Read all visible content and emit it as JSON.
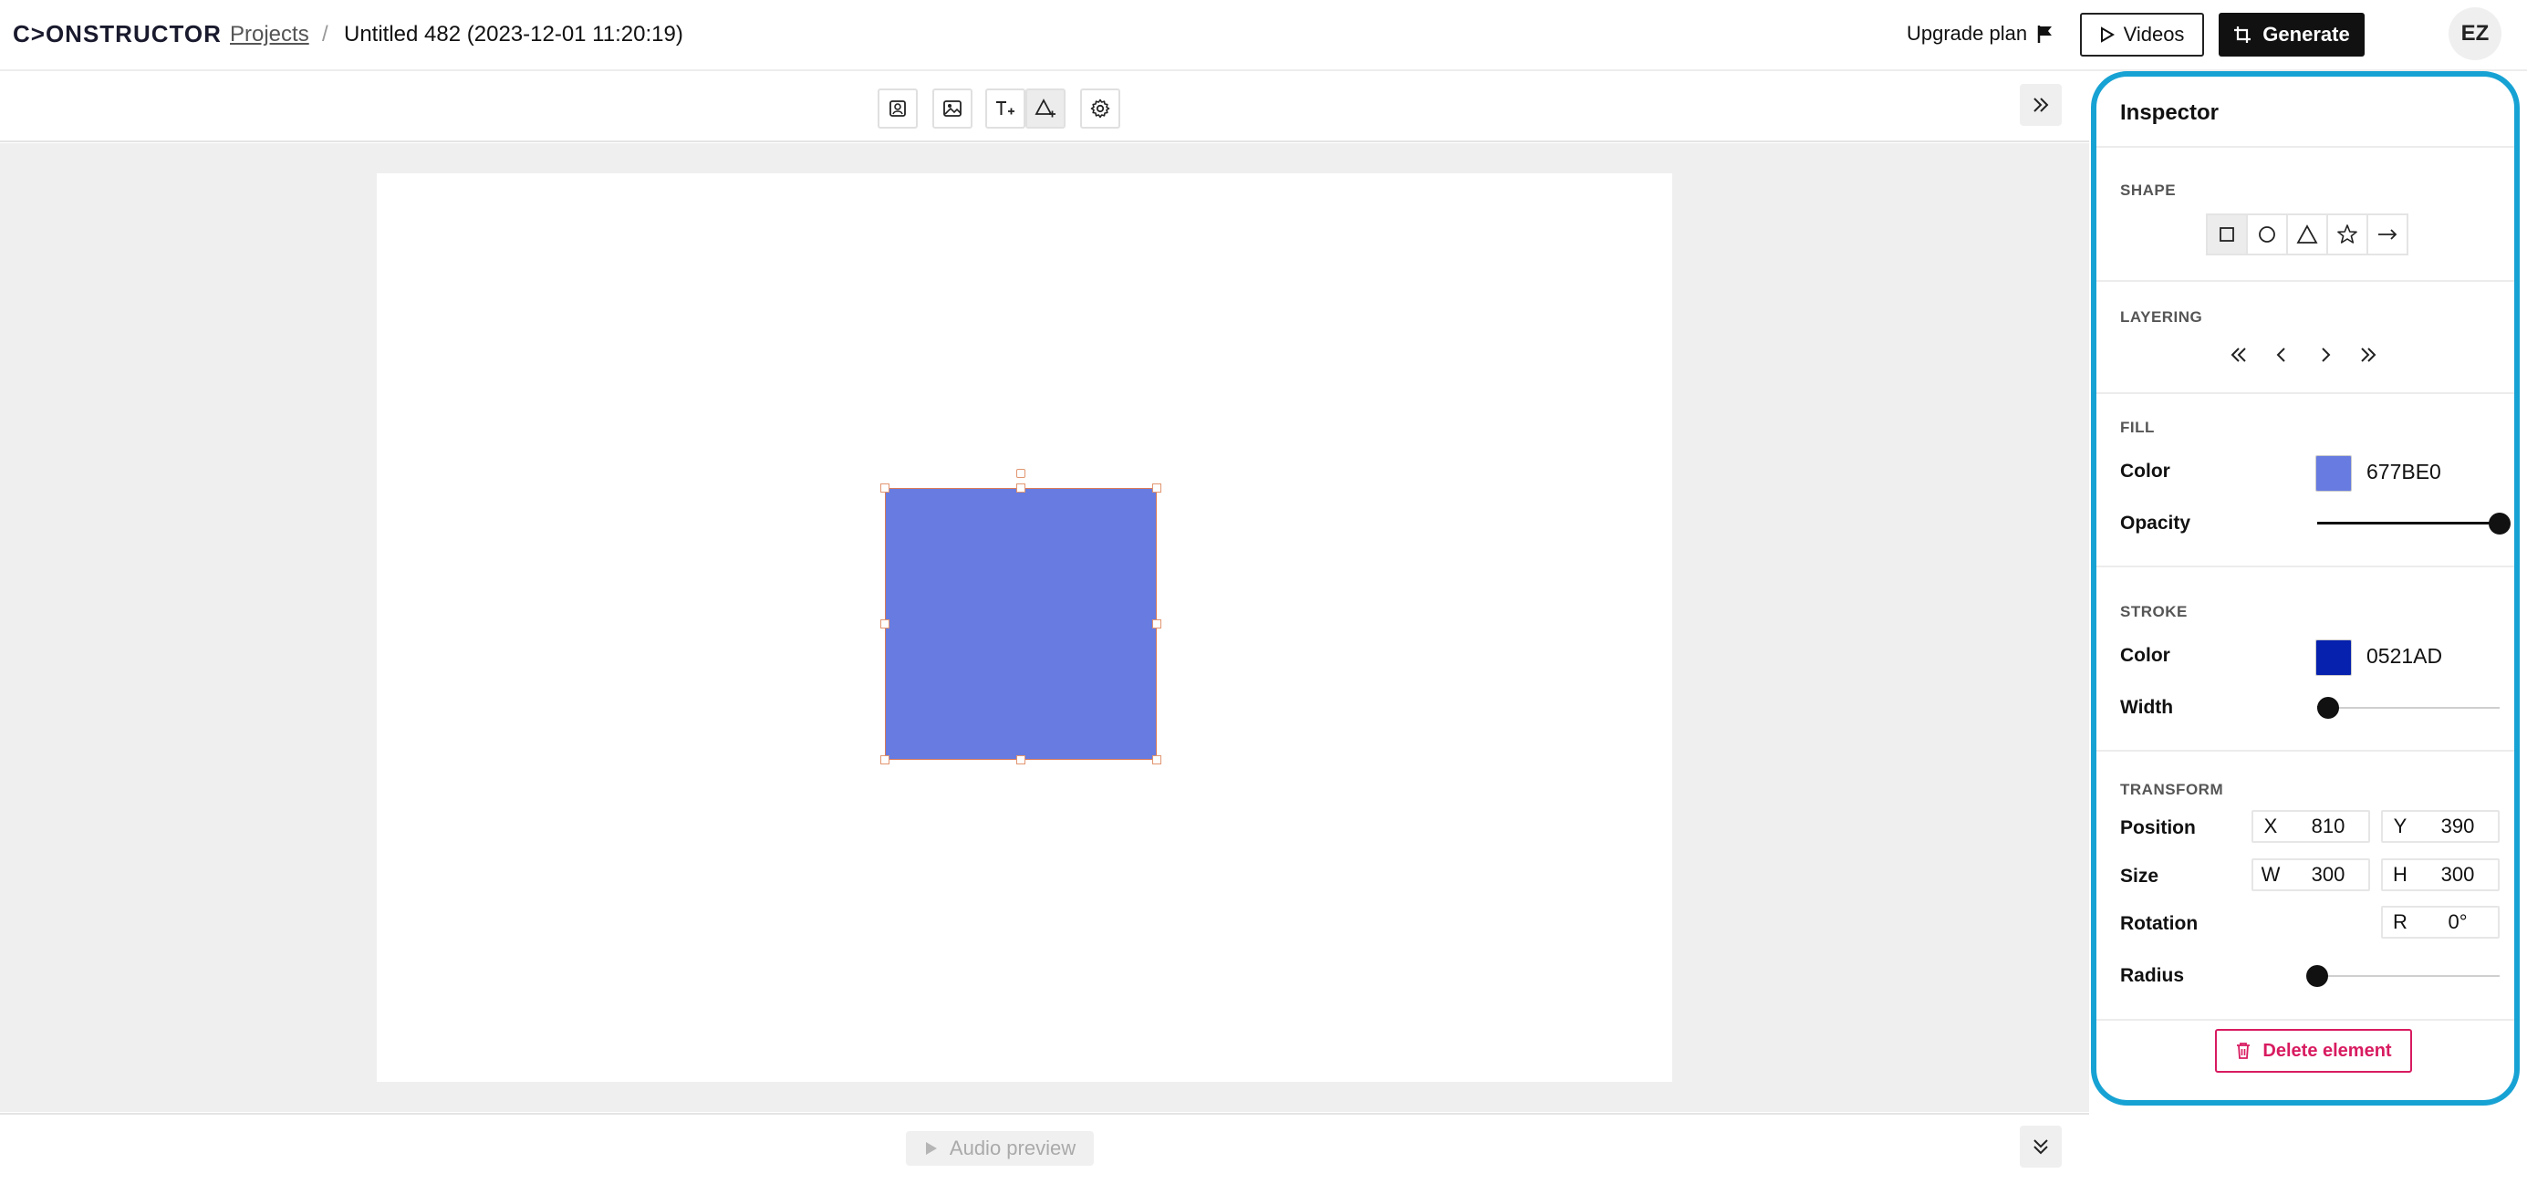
{
  "header": {
    "logo_text": "C>ONSTRUCTOR",
    "breadcrumb_projects": "Projects",
    "breadcrumb_separator": "/",
    "project_title": "Untitled 482 (2023-12-01 11:20:19)",
    "upgrade_label": "Upgrade plan",
    "videos_label": "Videos",
    "generate_label": "Generate",
    "avatar_initials": "EZ"
  },
  "toolbar": {
    "tools": [
      "avatar-tool",
      "image-tool",
      "text-tool",
      "shape-tool",
      "settings-tool"
    ],
    "active_tool": "shape-tool"
  },
  "canvas": {
    "shape_fill": "#677BE0",
    "shape_stroke": "#0521AD"
  },
  "bottombar": {
    "audio_preview_label": "Audio preview"
  },
  "inspector": {
    "title": "Inspector",
    "shape": {
      "label": "SHAPE",
      "options": [
        "square",
        "circle",
        "triangle",
        "star",
        "arrow"
      ],
      "selected": "square"
    },
    "layering": {
      "label": "LAYERING",
      "actions": [
        "send-to-back",
        "send-backward",
        "bring-forward",
        "bring-to-front"
      ]
    },
    "fill": {
      "label": "FILL",
      "color_label": "Color",
      "color_hex": "677BE0",
      "color_value": "#677BE0",
      "opacity_label": "Opacity",
      "opacity": 1.0
    },
    "stroke": {
      "label": "STROKE",
      "color_label": "Color",
      "color_hex": "0521AD",
      "color_value": "#0521AD",
      "width_label": "Width",
      "width_fraction": 0.06
    },
    "transform": {
      "label": "TRANSFORM",
      "position_label": "Position",
      "x_label": "X",
      "x_value": "810",
      "y_label": "Y",
      "y_value": "390",
      "size_label": "Size",
      "w_label": "W",
      "w_value": "300",
      "h_label": "H",
      "h_value": "300",
      "rotation_label": "Rotation",
      "r_label": "R",
      "r_value": "0°",
      "radius_label": "Radius",
      "radius_fraction": 0.0
    },
    "delete_label": "Delete element",
    "accent_color": "#17A2D4",
    "danger_color": "#D81B60"
  }
}
